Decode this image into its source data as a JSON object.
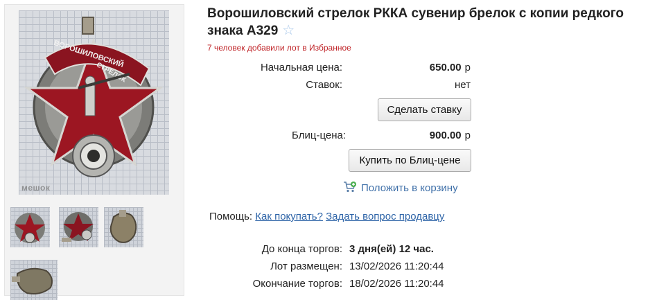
{
  "lot": {
    "title": "Ворошиловский стрелок РККА сувенир брелок с копии редкого знака А329",
    "favorites_note": "7 человек добавили лот в Избранное"
  },
  "photos": {
    "main_watermark": "мешок",
    "badge_text_top": "ВОРОШИЛОВСКИЙ",
    "badge_text_bottom": "СТРЕЛОК",
    "thumbnails": [
      "thumb-1",
      "thumb-2",
      "thumb-3",
      "thumb-4"
    ]
  },
  "pricing": {
    "start_label": "Начальная цена:",
    "start_value": "650.00",
    "currency": "р",
    "bids_label": "Ставок:",
    "bids_value": "нет",
    "bid_button": "Сделать ставку",
    "blitz_label": "Блиц-цена:",
    "blitz_value": "900.00",
    "blitz_button": "Купить по Блиц-цене",
    "cart_link": "Положить в корзину"
  },
  "help": {
    "label": "Помощь:",
    "how_to_buy": "Как покупать?",
    "ask_seller": "Задать вопрос продавцу"
  },
  "timing": {
    "ends_in_label": "До конца торгов:",
    "ends_in_value": "3 дня(ей) 12 час.",
    "posted_label": "Лот размещен:",
    "posted_value": "13/02/2026 11:20:44",
    "end_label": "Окончание торгов:",
    "end_value": "18/02/2026 11:20:44"
  },
  "colors": {
    "accent_link": "#2f65a8",
    "favorites_red": "#c0262a",
    "star_outline": "#a9c8ea",
    "badge_red": "#9c1622"
  },
  "icons": {
    "favorite": "star-outline-icon",
    "cart": "cart-add-icon"
  }
}
